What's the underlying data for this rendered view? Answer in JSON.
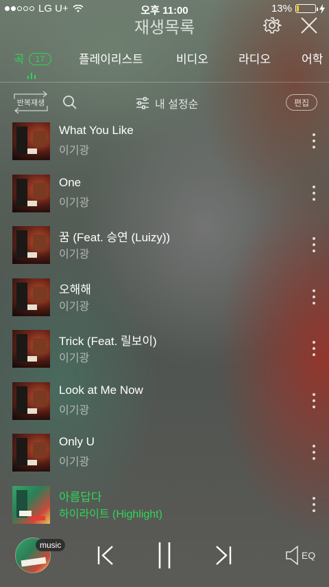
{
  "status_bar": {
    "carrier": "LG U+",
    "time": "오후 11:00",
    "battery_percent": "13%",
    "battery_level": 0.13,
    "signal_bars_filled": 2,
    "signal_bars_total": 5
  },
  "header": {
    "title": "재생목록",
    "settings_icon": "gear-icon",
    "close_icon": "close-icon"
  },
  "tabs": [
    {
      "label": "곡",
      "badge": "17",
      "active": true
    },
    {
      "label": "플레이리스트",
      "active": false
    },
    {
      "label": "비디오",
      "active": false
    },
    {
      "label": "라디오",
      "active": false
    },
    {
      "label": "어학",
      "active": false
    }
  ],
  "toolbar": {
    "repeat_label": "반복재생",
    "sort_label": "내 설정순",
    "edit_label": "편집"
  },
  "songs": [
    {
      "title": "What You Like",
      "artist": "이기광",
      "playing": false
    },
    {
      "title": "One",
      "artist": "이기광",
      "playing": false
    },
    {
      "title": "꿈 (Feat. 승연 (Luizy))",
      "artist": "이기광",
      "playing": false
    },
    {
      "title": "오해해",
      "artist": "이기광",
      "playing": false
    },
    {
      "title": "Trick (Feat. 릴보이)",
      "artist": "이기광",
      "playing": false
    },
    {
      "title": "Look at Me Now",
      "artist": "이기광",
      "playing": false
    },
    {
      "title": "Only U",
      "artist": "이기광",
      "playing": false
    },
    {
      "title": "아름답다",
      "artist": "하이라이트 (Highlight)",
      "playing": true
    }
  ],
  "player": {
    "badge": "music",
    "eq_label": "EQ",
    "accent_color": "#2fd65a"
  }
}
